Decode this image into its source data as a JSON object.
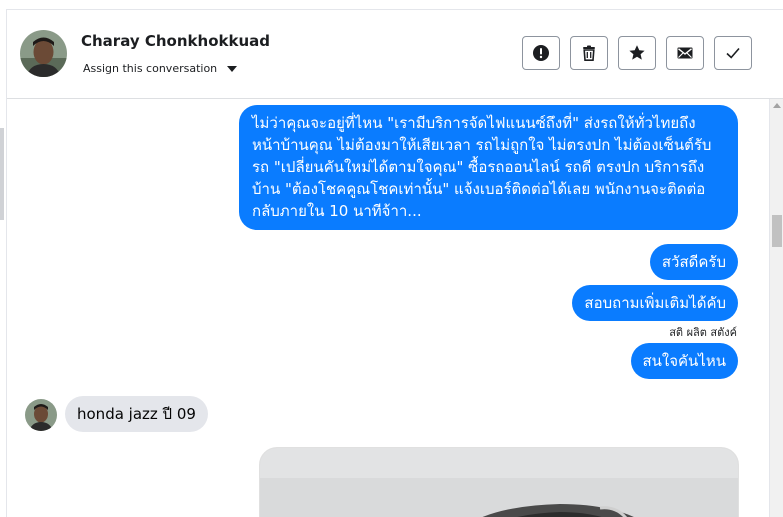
{
  "header": {
    "contact_name": "Charay Chonkhokkuad",
    "assign_label": "Assign this conversation",
    "actions": [
      {
        "name": "mark-spam-button",
        "icon": "exclamation-icon"
      },
      {
        "name": "delete-button",
        "icon": "trash-icon"
      },
      {
        "name": "star-button",
        "icon": "star-icon"
      },
      {
        "name": "mark-unread-button",
        "icon": "envelope-icon"
      },
      {
        "name": "mark-done-button",
        "icon": "check-icon"
      }
    ]
  },
  "messages": {
    "long_lines": [
      "ไม่ว่าคุณจะอยู่ที่ไหน \"เรามีบริการจัดไฟแนนซ์ถึงที่\"  ส่งรถให้ทั่วไทยถึง",
      "หน้าบ้านคุณ ไม่ต้องมาให้เสียเวลา รถไม่ถูกใจ ไม่ตรงปก ไม่ต้องเซ็นต์รับ",
      "รถ \"เปลี่ยนคันใหม่ได้ตามใจคุณ\" ซื้อรถออนไลน์ รถดี ตรงปก บริการถึง",
      "บ้าน \"ต้องโชคคูณโชคเท่านั้น\" แจ้งเบอร์ติดต่อได้เลย พนักงานจะติดต่อ",
      "กลับภายใน 10 นาทีจ้าา..."
    ],
    "greeting": "สวัสดีครับ",
    "more_info": "สอบถามเพิ่มเติมได้คับ",
    "sender_note": "สติ ผลิต สตังค์",
    "which_car": "สนใจคันไหน",
    "incoming": "honda jazz ปี 09"
  },
  "colors": {
    "outgoing_bubble": "#0a7cff",
    "incoming_bubble": "#e4e6eb"
  }
}
